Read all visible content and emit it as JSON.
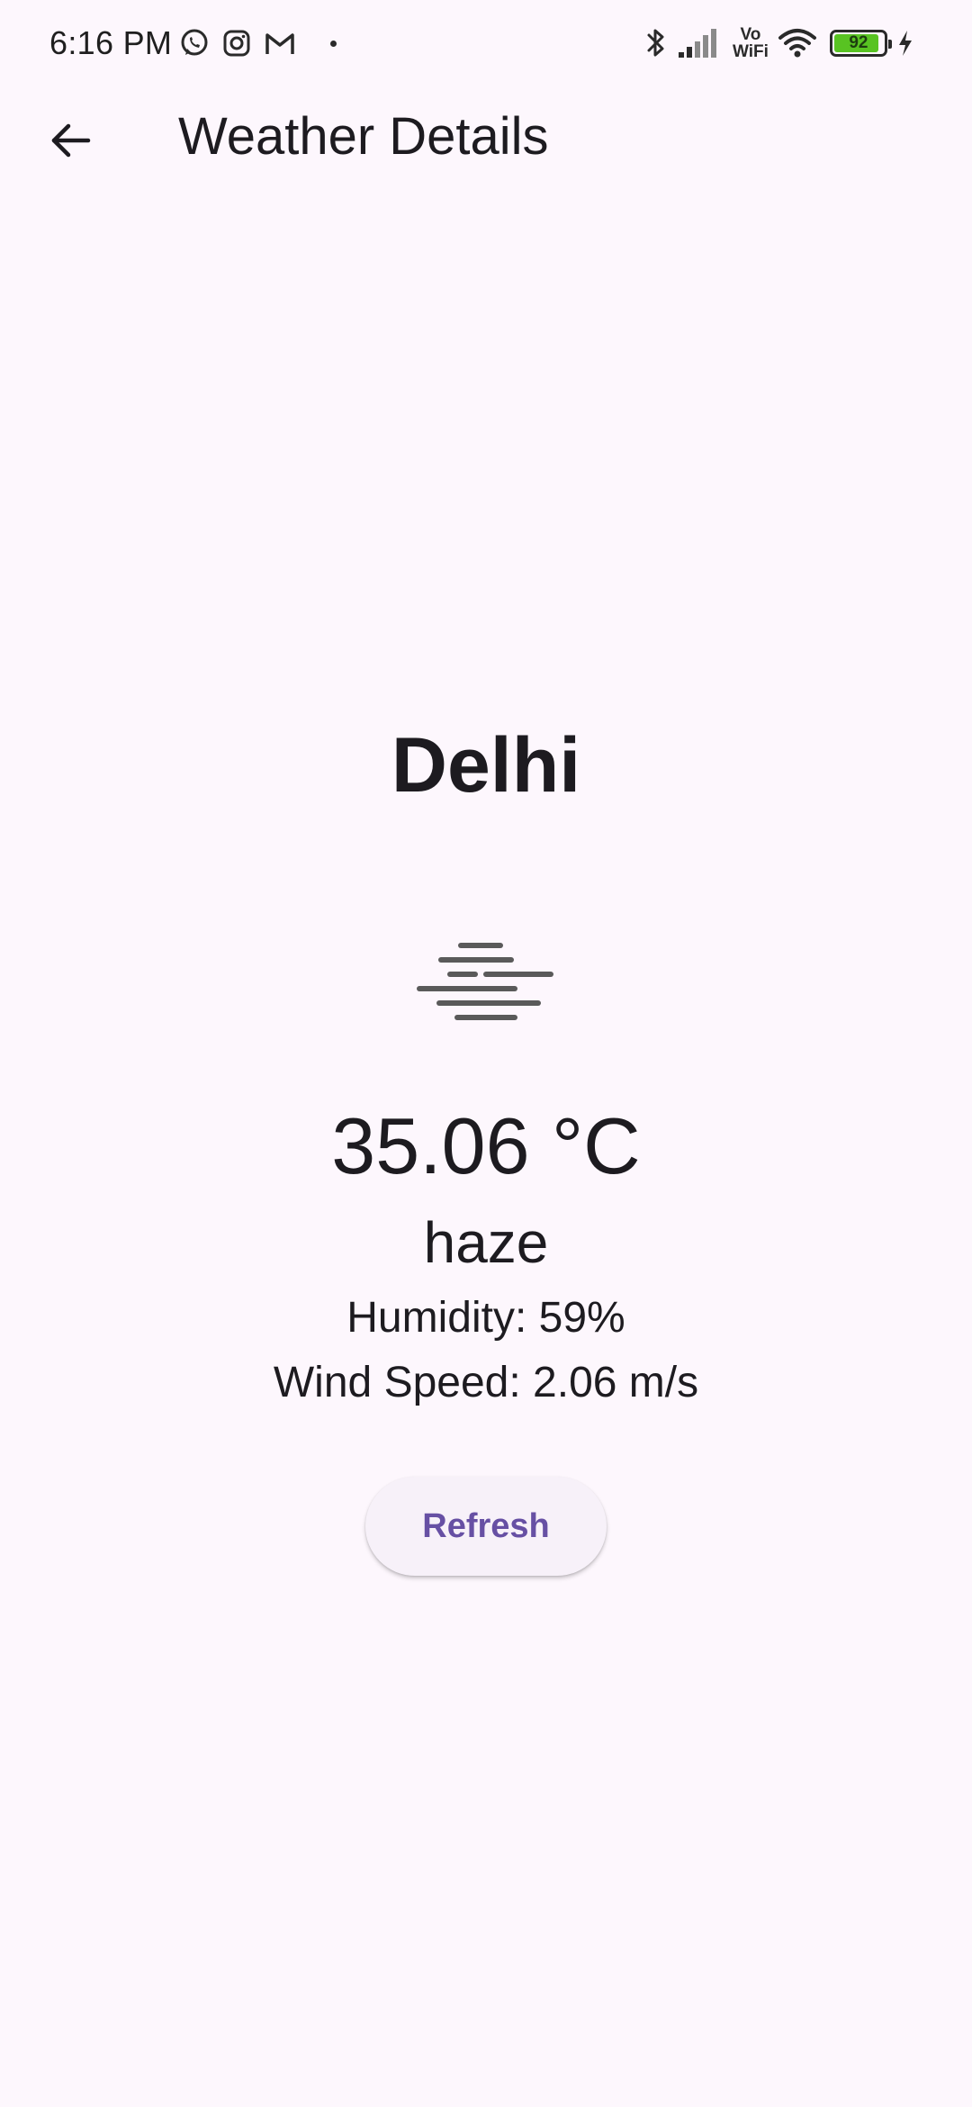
{
  "status_bar": {
    "time": "6:16 PM",
    "notification_icons": [
      "whatsapp-icon",
      "instagram-icon",
      "gmail-icon",
      "more-dot-icon"
    ],
    "system_icons": [
      "bluetooth-icon",
      "signal-icon",
      "vowifi-icon",
      "wifi-icon",
      "battery-icon",
      "charging-icon"
    ],
    "vowifi_top": "Vo",
    "vowifi_bottom": "WiFi",
    "battery_level": "92",
    "battery_fraction": 0.92,
    "battery_color": "#58c322"
  },
  "app_bar": {
    "back_icon": "arrow-back-icon",
    "title": "Weather Details"
  },
  "weather": {
    "city": "Delhi",
    "icon": "haze-icon",
    "temperature": "35.06 °C",
    "description": "haze",
    "humidity": "Humidity: 59%",
    "wind_speed": "Wind Speed: 2.06 m/s"
  },
  "actions": {
    "refresh_label": "Refresh"
  },
  "colors": {
    "background": "#fdf7fd",
    "text": "#1d1b20",
    "accent": "#6750a4",
    "button_surface": "#f7f1f9"
  }
}
